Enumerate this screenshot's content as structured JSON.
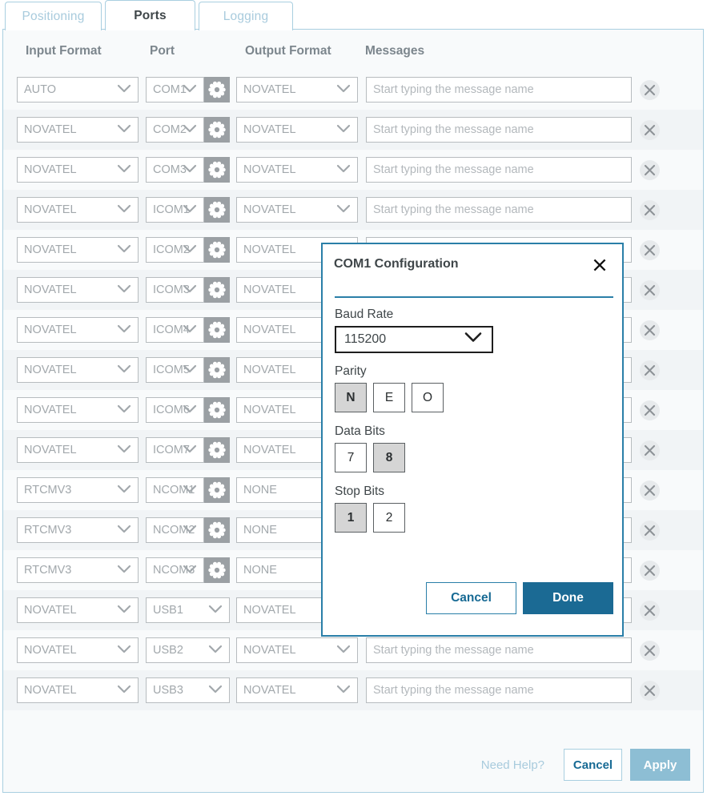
{
  "tabs": [
    {
      "label": "Positioning",
      "active": false
    },
    {
      "label": "Ports",
      "active": true
    },
    {
      "label": "Logging",
      "active": false
    }
  ],
  "table": {
    "headers": {
      "input_format": "Input Format",
      "port": "Port",
      "output_format": "Output Format",
      "messages": "Messages"
    },
    "message_placeholder": "Start typing the message name",
    "rows": [
      {
        "input": "AUTO",
        "port": "COM1",
        "output": "NOVATEL",
        "gear": true
      },
      {
        "input": "NOVATEL",
        "port": "COM2",
        "output": "NOVATEL",
        "gear": true
      },
      {
        "input": "NOVATEL",
        "port": "COM3",
        "output": "NOVATEL",
        "gear": true
      },
      {
        "input": "NOVATEL",
        "port": "ICOM1",
        "output": "NOVATEL",
        "gear": true
      },
      {
        "input": "NOVATEL",
        "port": "ICOM2",
        "output": "NOVATEL",
        "gear": true
      },
      {
        "input": "NOVATEL",
        "port": "ICOM3",
        "output": "NOVATEL",
        "gear": true
      },
      {
        "input": "NOVATEL",
        "port": "ICOM4",
        "output": "NOVATEL",
        "gear": true
      },
      {
        "input": "NOVATEL",
        "port": "ICOM5",
        "output": "NOVATEL",
        "gear": true
      },
      {
        "input": "NOVATEL",
        "port": "ICOM6",
        "output": "NOVATEL",
        "gear": true
      },
      {
        "input": "NOVATEL",
        "port": "ICOM7",
        "output": "NOVATEL",
        "gear": true
      },
      {
        "input": "RTCMV3",
        "port": "NCOM1",
        "output": "NONE",
        "gear": true
      },
      {
        "input": "RTCMV3",
        "port": "NCOM2",
        "output": "NONE",
        "gear": true
      },
      {
        "input": "RTCMV3",
        "port": "NCOM3",
        "output": "NONE",
        "gear": true
      },
      {
        "input": "NOVATEL",
        "port": "USB1",
        "output": "NOVATEL",
        "gear": false
      },
      {
        "input": "NOVATEL",
        "port": "USB2",
        "output": "NOVATEL",
        "gear": false
      },
      {
        "input": "NOVATEL",
        "port": "USB3",
        "output": "NOVATEL",
        "gear": false
      }
    ]
  },
  "footer": {
    "need_help": "Need Help?",
    "cancel": "Cancel",
    "apply": "Apply"
  },
  "modal": {
    "title": "COM1 Configuration",
    "close_icon": "close-icon",
    "baud_rate": {
      "label": "Baud Rate",
      "value": "115200"
    },
    "parity": {
      "label": "Parity",
      "options": [
        "N",
        "E",
        "O"
      ],
      "selected": "N"
    },
    "data_bits": {
      "label": "Data Bits",
      "options": [
        "7",
        "8"
      ],
      "selected": "8"
    },
    "stop_bits": {
      "label": "Stop Bits",
      "options": [
        "1",
        "2"
      ],
      "selected": "1"
    },
    "cancel": "Cancel",
    "done": "Done"
  },
  "colors": {
    "accent": "#1b6a94",
    "tab_border": "#a9cfe0",
    "apply_disabled": "#8dbed4",
    "gear_bg": "#9ba0a4"
  }
}
